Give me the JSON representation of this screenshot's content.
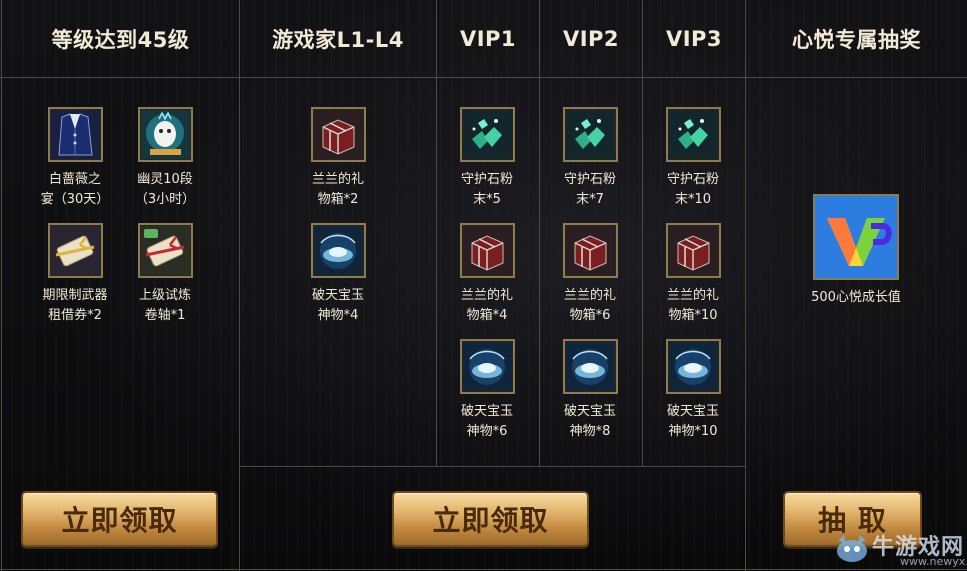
{
  "columns": {
    "level": {
      "title": "等级达到45级"
    },
    "gamer": {
      "title": "游戏家L1-L4"
    },
    "vip1": {
      "title": "VIP1"
    },
    "vip2": {
      "title": "VIP2"
    },
    "vip3": {
      "title": "VIP3"
    },
    "lottery": {
      "title": "心悦专属抽奖"
    }
  },
  "level_items": [
    {
      "name": "白蔷薇之\n宴（30天）",
      "icon": "white-suit-icon"
    },
    {
      "name": "幽灵10段\n（3小时）",
      "icon": "ghost-pet-icon"
    },
    {
      "name": "期限制武器\n租借券*2",
      "icon": "weapon-scroll-icon"
    },
    {
      "name": "上级试炼\n卷轴*1",
      "icon": "trial-scroll-icon"
    }
  ],
  "gamer_items": [
    {
      "name": "兰兰的礼\n物箱*2",
      "icon": "gift-box-icon"
    },
    {
      "name": "破天宝玉\n神物*4",
      "icon": "jade-relic-icon"
    }
  ],
  "vip1_items": [
    {
      "name": "守护石粉\n末*5",
      "icon": "stone-powder-icon"
    },
    {
      "name": "兰兰的礼\n物箱*4",
      "icon": "gift-box-icon"
    },
    {
      "name": "破天宝玉\n神物*6",
      "icon": "jade-relic-icon"
    }
  ],
  "vip2_items": [
    {
      "name": "守护石粉\n末*7",
      "icon": "stone-powder-icon"
    },
    {
      "name": "兰兰的礼\n物箱*6",
      "icon": "gift-box-icon"
    },
    {
      "name": "破天宝玉\n神物*8",
      "icon": "jade-relic-icon"
    }
  ],
  "vip3_items": [
    {
      "name": "守护石粉\n末*10",
      "icon": "stone-powder-icon"
    },
    {
      "name": "兰兰的礼\n物箱*10",
      "icon": "gift-box-icon"
    },
    {
      "name": "破天宝玉\n神物*10",
      "icon": "jade-relic-icon"
    }
  ],
  "lottery_item": {
    "name": "500心悦成长值",
    "icon": "vip-growth-icon"
  },
  "buttons": {
    "claim_level": "立即领取",
    "claim_vip": "立即领取",
    "draw": "抽 取"
  },
  "watermark": {
    "brand": "牛游戏网",
    "url": "www.newyx.net"
  },
  "colors": {
    "accent_gold": "#e0b26a",
    "button_text": "#4a2a0c",
    "line": "#4c4a44",
    "text": "#f2ead6"
  }
}
